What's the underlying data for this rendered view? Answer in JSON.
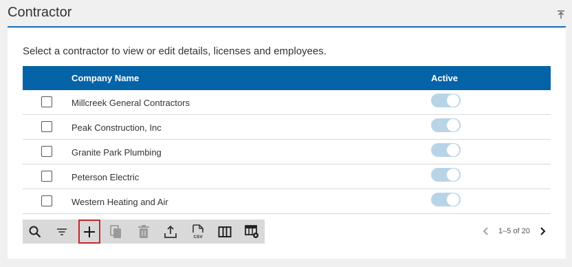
{
  "header": {
    "title": "Contractor"
  },
  "panel": {
    "description": "Select a contractor to view or edit details, licenses and employees."
  },
  "table": {
    "columns": {
      "name": "Company Name",
      "active": "Active"
    },
    "rows": [
      {
        "name": "Millcreek General Contractors",
        "active": true
      },
      {
        "name": "Peak Construction, Inc",
        "active": true
      },
      {
        "name": "Granite Park Plumbing",
        "active": true
      },
      {
        "name": "Peterson Electric",
        "active": true
      },
      {
        "name": "Western Heating and Air",
        "active": true
      }
    ]
  },
  "toolbar": {
    "buttons": [
      {
        "icon": "search-icon"
      },
      {
        "icon": "filter-icon"
      },
      {
        "icon": "add-icon"
      },
      {
        "icon": "copy-icon"
      },
      {
        "icon": "delete-icon"
      },
      {
        "icon": "export-icon"
      },
      {
        "icon": "csv-icon",
        "label": "CSV"
      },
      {
        "icon": "columns-icon"
      },
      {
        "icon": "table-settings-icon"
      }
    ]
  },
  "pager": {
    "label": "1–5 of 20"
  },
  "colors": {
    "header_border": "#1a6fb5",
    "table_header": "#0563a8",
    "toggle_track": "#b9d4e7",
    "toolbar_bg": "#d9d9d9",
    "highlight": "#c0272d"
  }
}
